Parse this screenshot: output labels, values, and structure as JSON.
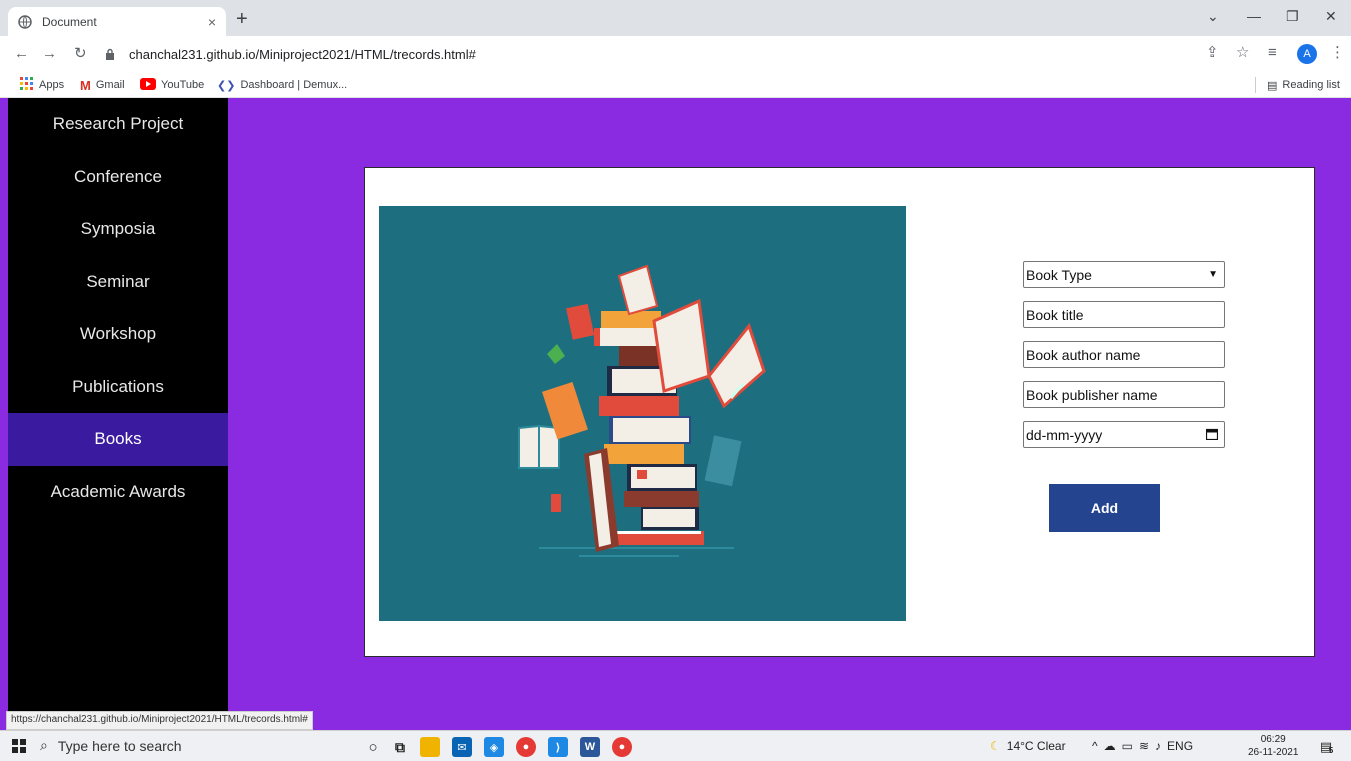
{
  "browser": {
    "tab_title": "Document",
    "tab_close": "×",
    "new_tab": "+",
    "url": "chanchal231.github.io/Miniproject2021/HTML/trecords.html#",
    "reading_list": "Reading list",
    "avatar_letter": "A",
    "bookmarks": [
      "Apps",
      "Gmail",
      "YouTube",
      "Dashboard | Demux..."
    ],
    "status_url": "https://chanchal231.github.io/Miniproject2021/HTML/trecords.html#"
  },
  "sidebar": {
    "items": [
      {
        "label": "Research Project"
      },
      {
        "label": "Conference"
      },
      {
        "label": "Symposia"
      },
      {
        "label": "Seminar"
      },
      {
        "label": "Workshop"
      },
      {
        "label": "Publications"
      },
      {
        "label": "Books"
      },
      {
        "label": "Academic Awards"
      }
    ],
    "active": "Books"
  },
  "form": {
    "book_type": "Book Type",
    "book_title": "Book title",
    "author": "Book author name",
    "publisher": "Book publisher name",
    "date": "dd-mm-yyyy",
    "add_label": "Add"
  },
  "taskbar": {
    "search_placeholder": "Type here to search",
    "weather": "14°C  Clear",
    "lang": "ENG",
    "time": "06:29",
    "date": "26-11-2021",
    "notif_count": "5"
  },
  "colors": {
    "page_bg": "#8a2be2",
    "sidebar_bg": "#000000",
    "sidebar_active": "#3a1a9e",
    "add_button": "#24448f",
    "illustration_bg": "#1d6f7f"
  }
}
